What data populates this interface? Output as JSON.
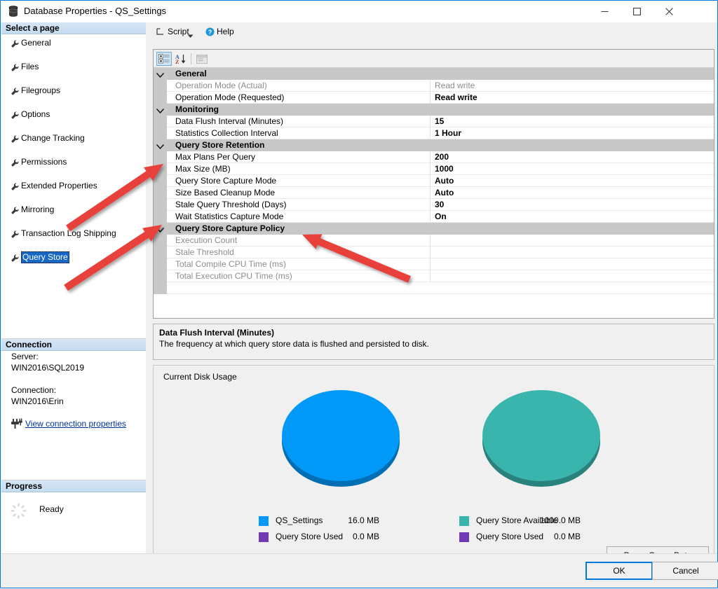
{
  "window": {
    "title": "Database Properties - QS_Settings",
    "icon": "database-icon",
    "minimize": "minimize-icon",
    "maximize": "maximize-icon",
    "close": "close-icon"
  },
  "sidebar": {
    "header": "Select a page",
    "items": [
      {
        "label": "General",
        "selected": false
      },
      {
        "label": "Files",
        "selected": false
      },
      {
        "label": "Filegroups",
        "selected": false
      },
      {
        "label": "Options",
        "selected": false
      },
      {
        "label": "Change Tracking",
        "selected": false
      },
      {
        "label": "Permissions",
        "selected": false
      },
      {
        "label": "Extended Properties",
        "selected": false
      },
      {
        "label": "Mirroring",
        "selected": false
      },
      {
        "label": "Transaction Log Shipping",
        "selected": false
      },
      {
        "label": "Query Store",
        "selected": true
      }
    ],
    "connection": {
      "header": "Connection",
      "server_label": "Server:",
      "server_value": "WIN2016\\SQL2019",
      "connection_label": "Connection:",
      "connection_value": "WIN2016\\Erin",
      "link": "View connection properties",
      "link_icon": "connection-icon"
    },
    "progress": {
      "header": "Progress",
      "status": "Ready",
      "icon": "spinner-icon"
    }
  },
  "toolbar": {
    "script_label": "Script",
    "script_icon": "script-icon",
    "script_caret": "chevron-down-icon",
    "help_label": "Help",
    "help_icon": "help-icon"
  },
  "grid_toolbar": {
    "categorized_icon": "categorized-view-icon",
    "alphabetical_icon": "sort-alphabetical-icon",
    "property_pages_icon": "property-pages-icon"
  },
  "grid": {
    "rows": [
      {
        "type": "category",
        "name": "General"
      },
      {
        "type": "property",
        "name": "Operation Mode (Actual)",
        "value": "Read write",
        "disabled": true
      },
      {
        "type": "property",
        "name": "Operation Mode (Requested)",
        "value": "Read write",
        "disabled": false
      },
      {
        "type": "category",
        "name": "Monitoring"
      },
      {
        "type": "property",
        "name": "Data Flush Interval (Minutes)",
        "value": "15",
        "disabled": false
      },
      {
        "type": "property",
        "name": "Statistics Collection Interval",
        "value": "1 Hour",
        "disabled": false
      },
      {
        "type": "category",
        "name": "Query Store Retention"
      },
      {
        "type": "property",
        "name": "Max Plans Per Query",
        "value": "200",
        "disabled": false
      },
      {
        "type": "property",
        "name": "Max Size (MB)",
        "value": "1000",
        "disabled": false
      },
      {
        "type": "property",
        "name": "Query Store Capture Mode",
        "value": "Auto",
        "disabled": false
      },
      {
        "type": "property",
        "name": "Size Based Cleanup Mode",
        "value": "Auto",
        "disabled": false
      },
      {
        "type": "property",
        "name": "Stale Query Threshold (Days)",
        "value": "30",
        "disabled": false
      },
      {
        "type": "property",
        "name": "Wait Statistics Capture Mode",
        "value": "On",
        "disabled": false
      },
      {
        "type": "category",
        "name": "Query Store Capture Policy"
      },
      {
        "type": "property",
        "name": "Execution Count",
        "value": "",
        "disabled": true
      },
      {
        "type": "property",
        "name": "Stale Threshold",
        "value": "",
        "disabled": true
      },
      {
        "type": "property",
        "name": "Total Compile CPU Time (ms)",
        "value": "",
        "disabled": true
      },
      {
        "type": "property",
        "name": "Total Execution CPU Time (ms)",
        "value": "",
        "disabled": true
      }
    ]
  },
  "description": {
    "title": "Data Flush Interval (Minutes)",
    "text": "The frequency at which query store data is flushed and persisted to disk."
  },
  "disk_usage": {
    "title": "Current Disk Usage",
    "purge_button": "Purge Query Data",
    "charts": [
      {
        "name": "database-disk-usage-chart",
        "color": "#0099F7",
        "legend": [
          {
            "label": "QS_Settings",
            "value": "16.0 MB",
            "color": "#0099F7"
          },
          {
            "label": "Query Store Used",
            "value": "0.0 MB",
            "color": "#7139B5"
          }
        ]
      },
      {
        "name": "query-store-disk-usage-chart",
        "color": "#3AB5AE",
        "legend": [
          {
            "label": "Query Store Available",
            "value": "1000.0 MB",
            "color": "#3AB5AE"
          },
          {
            "label": "Query Store Used",
            "value": "0.0 MB",
            "color": "#7139B5"
          }
        ]
      }
    ]
  },
  "footer": {
    "ok": "OK",
    "cancel": "Cancel"
  },
  "annotations": {
    "arrow_color": "#E8403A",
    "count": 3
  }
}
